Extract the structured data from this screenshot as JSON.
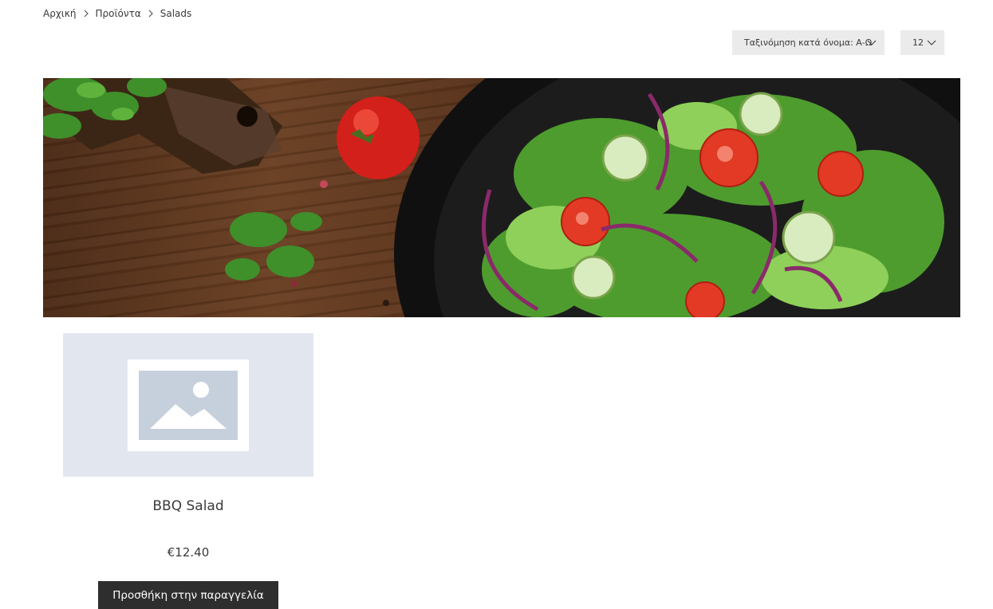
{
  "breadcrumb": {
    "home": "Αρχική",
    "products": "Προϊόντα",
    "current": "Salads"
  },
  "sort": {
    "selected": "Ταξινόμηση κατά όνομα: Α-Ω"
  },
  "per_page": {
    "selected": "12"
  },
  "product": {
    "title": "BBQ Salad",
    "price": "€12.40",
    "add_button_label": "Προσθήκη στην παραγγελία"
  },
  "colors": {
    "button_bg": "#2e2e2e",
    "select_bg": "#ebebeb",
    "placeholder_bg": "#e2e7ef"
  }
}
